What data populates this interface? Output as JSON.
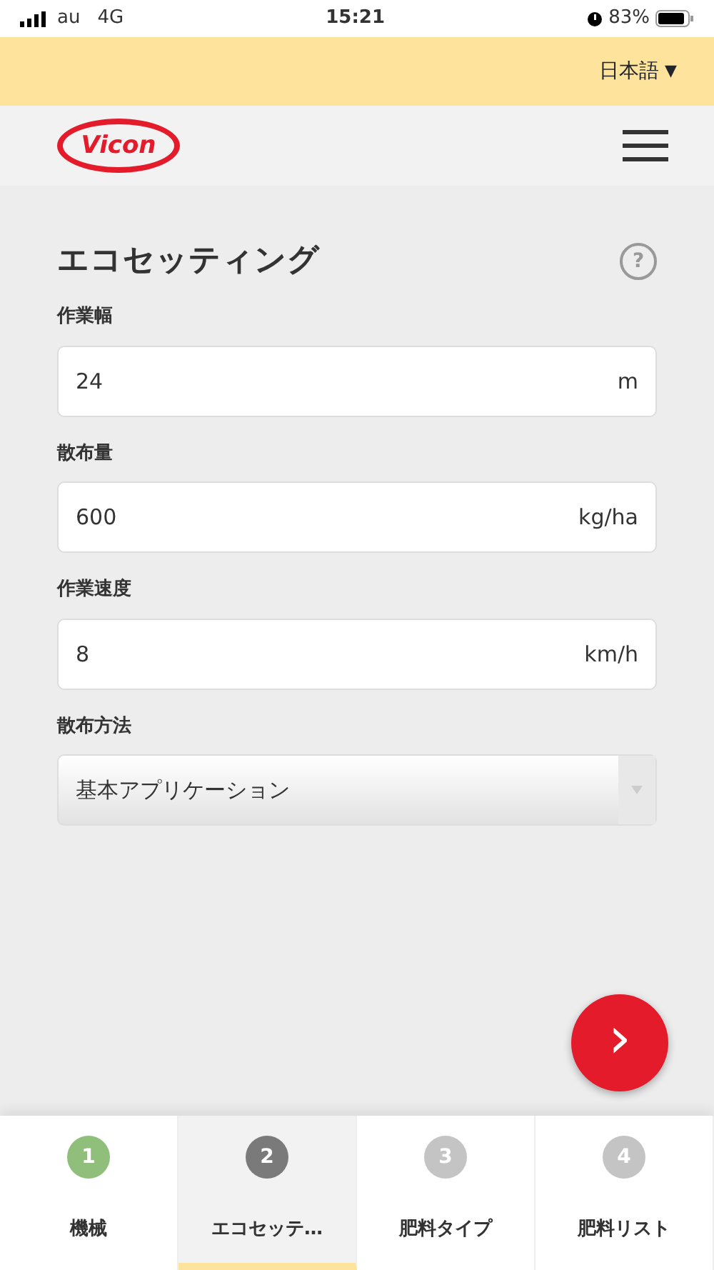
{
  "status_bar": {
    "carrier": "au",
    "network": "4G",
    "time": "15:21",
    "battery": "83%"
  },
  "language": {
    "label": "日本語",
    "caret": "▼"
  },
  "header": {
    "logo": "Vicon"
  },
  "page": {
    "title": "エコセッティング",
    "help": "?"
  },
  "fields": [
    {
      "kind": "input",
      "label": "作業幅",
      "value": "24",
      "unit": "m"
    },
    {
      "kind": "input",
      "label": "散布量",
      "value": "600",
      "unit": "kg/ha"
    },
    {
      "kind": "input",
      "label": "作業速度",
      "value": "8",
      "unit": "km/h"
    },
    {
      "kind": "select",
      "label": "散布方法",
      "value": "基本アプリケーション"
    }
  ],
  "next_button": "›",
  "steps": [
    {
      "number": "1",
      "label": "機械",
      "completed": true,
      "selected": false
    },
    {
      "number": "2",
      "label": "エコセッテ…",
      "completed": false,
      "selected": true
    },
    {
      "number": "3",
      "label": "肥料タイプ",
      "completed": false,
      "selected": false
    },
    {
      "number": "4",
      "label": "肥料リスト",
      "completed": false,
      "selected": false
    }
  ]
}
